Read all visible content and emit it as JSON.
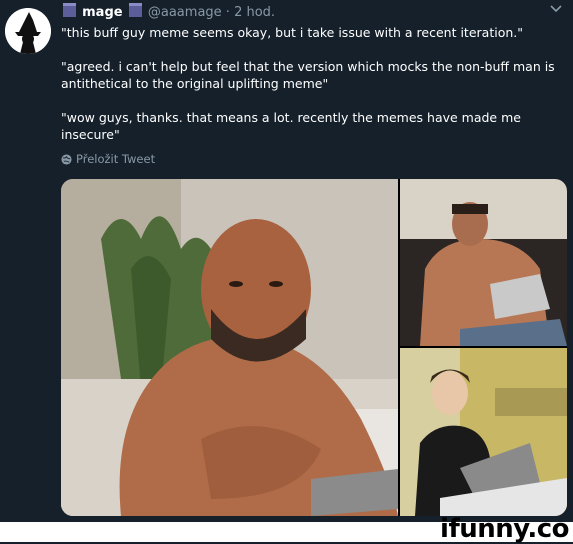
{
  "tweet": {
    "display_name": "mage",
    "handle": "@aaamage",
    "separator": "·",
    "time": "2 hod.",
    "lines": [
      "\"this buff guy meme seems okay, but i take issue with a recent iteration.\"",
      "\"agreed. i can't help but feel that the version which mocks the non-buff man is antithetical to the original uplifting meme\"",
      "\"wow guys, thanks. that means a lot. recently the memes have made me insecure\""
    ],
    "translate_label": "Přeložit Tweet"
  },
  "watermark": {
    "brand": "ifunny.co"
  },
  "colors": {
    "background": "#15202b",
    "muted": "#8899a6",
    "accent": "#1da1f2"
  },
  "icons": {
    "chevron": "chevron-down-icon",
    "globe": "globe-icon"
  }
}
